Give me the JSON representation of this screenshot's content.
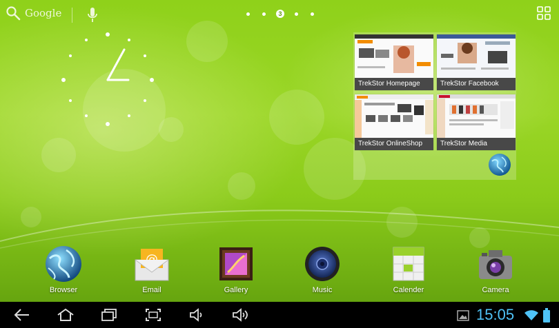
{
  "top_bar": {
    "search_label": "Google",
    "current_page": "3"
  },
  "bookmarks": [
    {
      "title": "TrekStor Homepage"
    },
    {
      "title": "TrekStor Facebook"
    },
    {
      "title": "TrekStor OnlineShop"
    },
    {
      "title": "TrekStor Media"
    }
  ],
  "dock": [
    {
      "label": "Browser",
      "icon": "globe-icon"
    },
    {
      "label": "Email",
      "icon": "envelope-icon"
    },
    {
      "label": "Gallery",
      "icon": "picture-frame-icon"
    },
    {
      "label": "Music",
      "icon": "speaker-icon"
    },
    {
      "label": "Calender",
      "icon": "calendar-icon"
    },
    {
      "label": "Camera",
      "icon": "camera-icon"
    }
  ],
  "status_bar": {
    "time": "15:05",
    "time_color": "#4fc3f7"
  }
}
